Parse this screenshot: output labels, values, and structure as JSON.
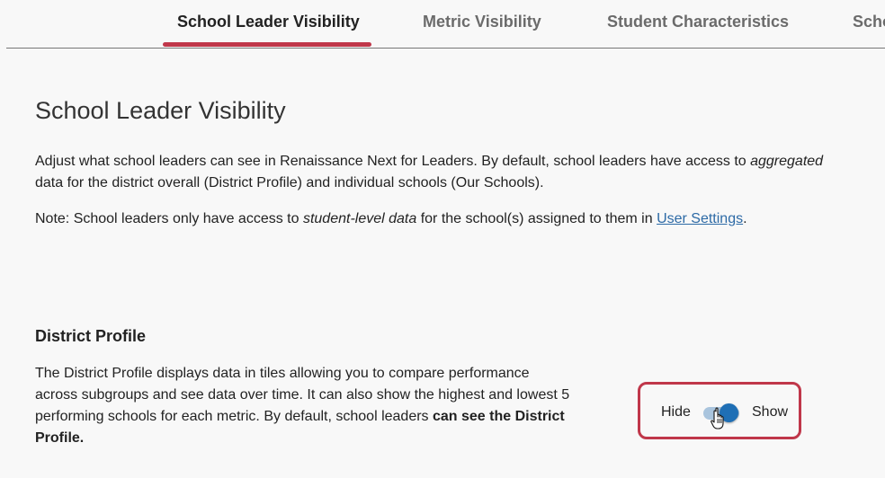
{
  "tabs": [
    {
      "label": "School Leader Visibility",
      "active": true
    },
    {
      "label": "Metric Visibility",
      "active": false
    },
    {
      "label": "Student Characteristics",
      "active": false
    },
    {
      "label": "Scho",
      "active": false
    }
  ],
  "colors": {
    "accent": "#c0374a",
    "toggle_on": "#1f6fb5",
    "link": "#2d6aa6"
  },
  "page": {
    "title": "School Leader Visibility",
    "intro": {
      "part1": "Adjust what school leaders can see in Renaissance Next for Leaders. By default, school leaders have access to ",
      "emphasis": "aggregated",
      "part2": " data for the district overall (District Profile) and individual schools (Our Schools)."
    },
    "note": {
      "part1": "Note: School leaders only have access to ",
      "emphasis": "student-level data",
      "part2": " for the school(s) assigned to them in ",
      "link": "User Settings",
      "part3": "."
    }
  },
  "district_profile": {
    "title": "District Profile",
    "description": "The District Profile displays data in tiles allowing you to compare performance across subgroups and see data over time. It can also show the highest and lowest 5 performing schools for each metric. By default, school leaders ",
    "description_bold": "can see the District Profile.",
    "toggle": {
      "off_label": "Hide",
      "on_label": "Show",
      "state": "on"
    }
  }
}
